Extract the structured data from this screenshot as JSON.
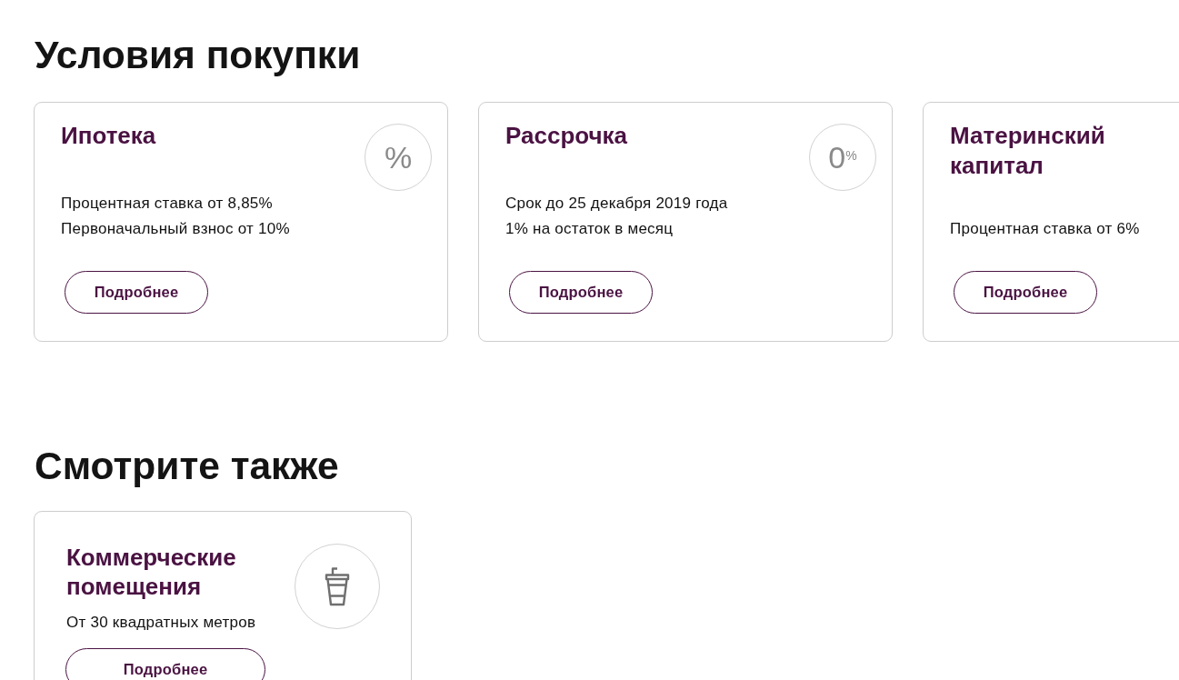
{
  "sections": [
    {
      "kind": "offers",
      "title": "Условия покупки",
      "cards": [
        {
          "title": "Ипотека",
          "emblem": {
            "kind": "text",
            "text": "%"
          },
          "lines": [
            "Процентная ставка от 8,85%",
            "Первоначальный взнос от 10%"
          ],
          "button": "Подробнее"
        },
        {
          "title": "Рассрочка",
          "emblem": {
            "kind": "text",
            "text": "0$^{%}$"
          },
          "lines": [
            "Срок до 25 декабря 2019 года",
            "1% на остаток в месяц"
          ],
          "button": "Подробнее"
        },
        {
          "title": "Материнский капитал",
          "lines": [
            "Процентная ставка от 6%"
          ],
          "button": "Подробнее"
        }
      ]
    },
    {
      "kind": "related",
      "title": "Смотрите также",
      "cards": [
        {
          "title": "Коммерческие помещения",
          "emblem": {
            "kind": "picture"
          },
          "lines": [
            "От 30 квадратных метров"
          ],
          "button": "Подробнее"
        }
      ]
    }
  ]
}
